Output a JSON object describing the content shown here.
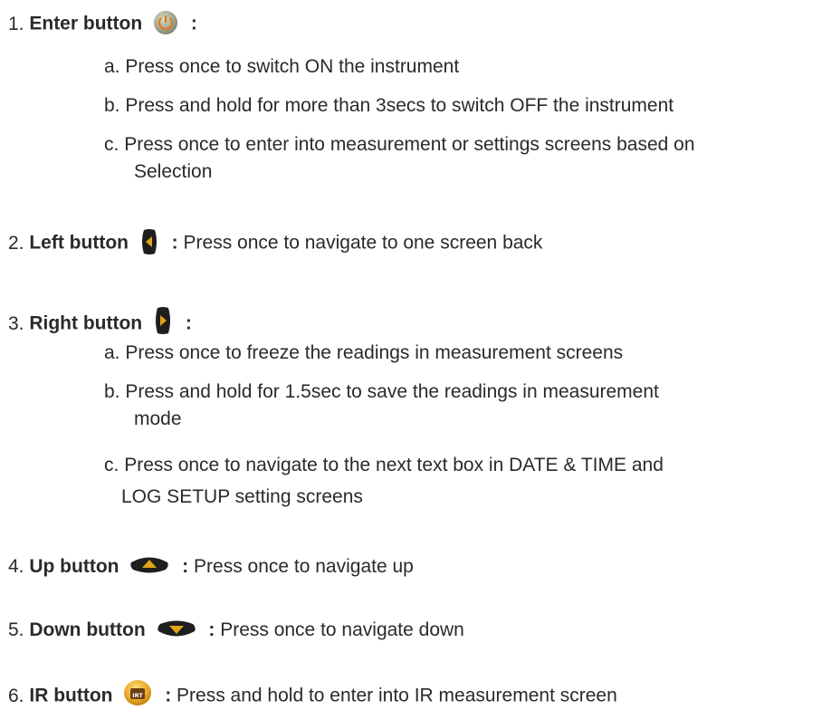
{
  "items": [
    {
      "number": "1.",
      "title": "Enter button",
      "icon": "power-icon",
      "desc": "",
      "subitems": [
        {
          "letter": "a.",
          "lines": [
            "Press once to switch ON the instrument"
          ]
        },
        {
          "letter": "b.",
          "lines": [
            "Press and hold for more than 3secs to switch OFF the instrument"
          ]
        },
        {
          "letter": "c.",
          "lines": [
            "Press once to enter into measurement or settings screens based on",
            "Selection"
          ]
        }
      ]
    },
    {
      "number": "2.",
      "title": "Left button",
      "icon": "left-arrow-button-icon",
      "desc": "Press once to navigate to one screen back"
    },
    {
      "number": "3.",
      "title": "Right button",
      "icon": "right-arrow-button-icon",
      "desc": "",
      "subitems": [
        {
          "letter": "a.",
          "lines": [
            "Press once to freeze the readings in measurement screens"
          ]
        },
        {
          "letter": "b.",
          "lines": [
            "Press and hold for 1.5sec to save the readings in measurement",
            "mode"
          ]
        },
        {
          "letter": "c.",
          "lines": [
            "Press once to navigate to the next text box in DATE & TIME and",
            "LOG SETUP setting screens"
          ]
        }
      ]
    },
    {
      "number": "4.",
      "title": "Up button",
      "icon": "up-arrow-button-icon",
      "desc": "Press once to navigate up"
    },
    {
      "number": "5.",
      "title": "Down button",
      "icon": "down-arrow-button-icon",
      "desc": "Press once to navigate down"
    },
    {
      "number": "6.",
      "title": "IR button",
      "icon": "ir-button-icon",
      "icon_text": "IRT",
      "desc": "Press and hold to enter into IR measurement screen"
    }
  ],
  "colon": ":"
}
